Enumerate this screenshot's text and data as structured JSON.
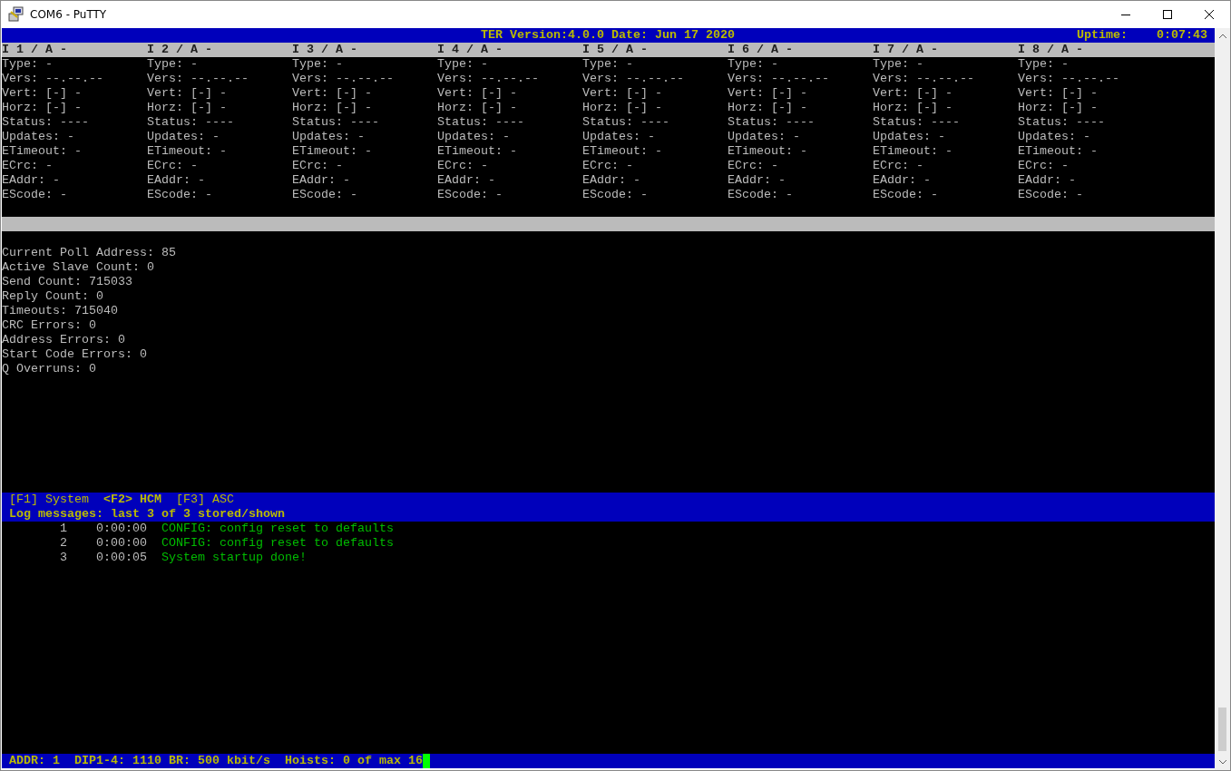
{
  "window": {
    "title": "COM6 - PuTTY"
  },
  "header": {
    "version": "TER Version:4.0.0 Date: Jun 17 2020",
    "uptime_label": "Uptime:",
    "uptime": "0:07:43"
  },
  "channels": [
    {
      "title": "I 1 / A -",
      "fields": [
        "Type: -",
        "Vers: --.--.--",
        "Vert: [-] -",
        "Horz: [-] -",
        "Status: ----",
        "Updates: -",
        "ETimeout: -",
        "ECrc: -",
        "EAddr: -",
        "EScode: -"
      ]
    },
    {
      "title": "I 2 / A -",
      "fields": [
        "Type: -",
        "Vers: --.--.--",
        "Vert: [-] -",
        "Horz: [-] -",
        "Status: ----",
        "Updates: -",
        "ETimeout: -",
        "ECrc: -",
        "EAddr: -",
        "EScode: -"
      ]
    },
    {
      "title": "I 3 / A -",
      "fields": [
        "Type: -",
        "Vers: --.--.--",
        "Vert: [-] -",
        "Horz: [-] -",
        "Status: ----",
        "Updates: -",
        "ETimeout: -",
        "ECrc: -",
        "EAddr: -",
        "EScode: -"
      ]
    },
    {
      "title": "I 4 / A -",
      "fields": [
        "Type: -",
        "Vers: --.--.--",
        "Vert: [-] -",
        "Horz: [-] -",
        "Status: ----",
        "Updates: -",
        "ETimeout: -",
        "ECrc: -",
        "EAddr: -",
        "EScode: -"
      ]
    },
    {
      "title": "I 5 / A -",
      "fields": [
        "Type: -",
        "Vers: --.--.--",
        "Vert: [-] -",
        "Horz: [-] -",
        "Status: ----",
        "Updates: -",
        "ETimeout: -",
        "ECrc: -",
        "EAddr: -",
        "EScode: -"
      ]
    },
    {
      "title": "I 6 / A -",
      "fields": [
        "Type: -",
        "Vers: --.--.--",
        "Vert: [-] -",
        "Horz: [-] -",
        "Status: ----",
        "Updates: -",
        "ETimeout: -",
        "ECrc: -",
        "EAddr: -",
        "EScode: -"
      ]
    },
    {
      "title": "I 7 / A -",
      "fields": [
        "Type: -",
        "Vers: --.--.--",
        "Vert: [-] -",
        "Horz: [-] -",
        "Status: ----",
        "Updates: -",
        "ETimeout: -",
        "ECrc: -",
        "EAddr: -",
        "EScode: -"
      ]
    },
    {
      "title": "I 8 / A -",
      "fields": [
        "Type: -",
        "Vers: --.--.--",
        "Vert: [-] -",
        "Horz: [-] -",
        "Status: ----",
        "Updates: -",
        "ETimeout: -",
        "ECrc: -",
        "EAddr: -",
        "EScode: -"
      ]
    }
  ],
  "stats": [
    "Current Poll Address: 85",
    "Active Slave Count: 0",
    "Send Count: 715033",
    "Reply Count: 0",
    "Timeouts: 715040",
    "CRC Errors: 0",
    "Address Errors: 0",
    "Start Code Errors: 0",
    "Q Overruns: 0"
  ],
  "tabs": [
    {
      "label": "[F1] System",
      "selected": false
    },
    {
      "label": "<F2> HCM",
      "selected": true
    },
    {
      "label": "[F3] ASC",
      "selected": false
    }
  ],
  "log": {
    "heading": "Log messages: last 3 of 3 stored/shown",
    "entries": [
      {
        "number": "1",
        "time": "0:00:00",
        "message": "CONFIG: config reset to defaults"
      },
      {
        "number": "2",
        "time": "0:00:00",
        "message": "CONFIG: config reset to defaults"
      },
      {
        "number": "3",
        "time": "0:00:05",
        "message": "System startup done!"
      }
    ]
  },
  "status_bar": "ADDR: 1  DIP1-4: 1110 BR: 500 kbit/s  Hoists: 0 of max 16"
}
